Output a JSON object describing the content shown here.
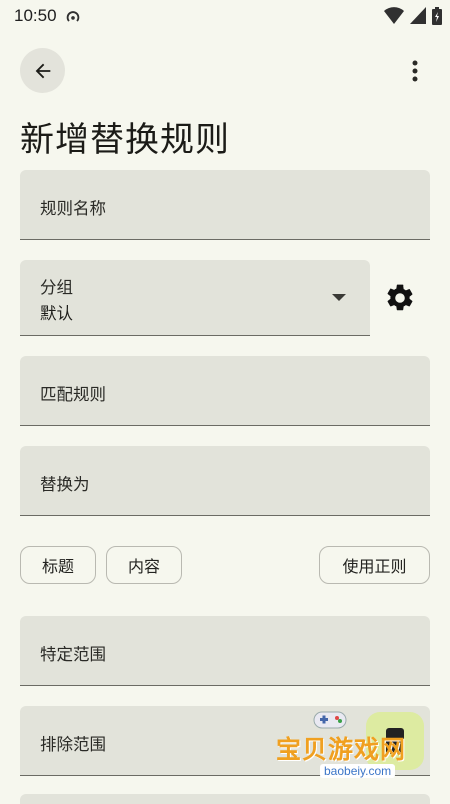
{
  "status_bar": {
    "time": "10:50"
  },
  "page": {
    "title": "新增替换规则"
  },
  "fields": {
    "rule_name": "规则名称",
    "match_rule": "匹配规则",
    "replace_with": "替换为",
    "specific_scope": "特定范围",
    "exclude_scope": "排除范围"
  },
  "group_dropdown": {
    "label": "分组",
    "value": "默认"
  },
  "chips": {
    "title": "标题",
    "content": "内容",
    "use_regex": "使用正则"
  },
  "watermark": {
    "text": "宝贝游戏网",
    "url": "baobeiy.com"
  },
  "icons": {
    "back": "arrow-left-icon",
    "overflow": "more-vert-icon",
    "settings": "gear-icon",
    "wifi": "wifi-icon",
    "signal": "signal-icon",
    "battery": "battery-icon"
  },
  "colors": {
    "background": "#f6f7ee",
    "field": "#e2e3da",
    "accent": "#f0a020"
  }
}
